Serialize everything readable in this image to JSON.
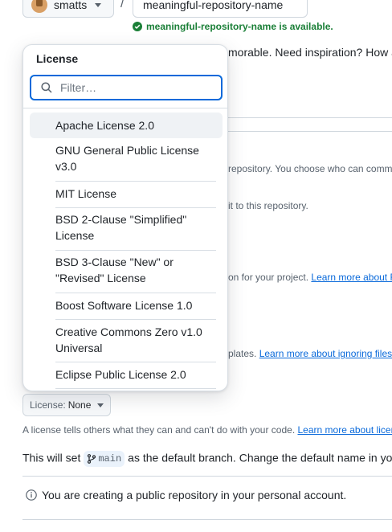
{
  "owner": {
    "name": "smatts"
  },
  "separator": "/",
  "repo_name": {
    "value": "meaningful-repository-name"
  },
  "availability": "meaningful-repository-name is available.",
  "background": {
    "inspiration": "morable. Need inspiration? How a",
    "visibility_desc": "repository. You choose who can comm",
    "commit_desc": "it to this repository.",
    "readme_desc": "on for your project.",
    "readme_link": "Learn more about R",
    "gitignore_desc": "plates.",
    "gitignore_link": "Learn more about ignoring files."
  },
  "license": {
    "button_prefix": "License:",
    "button_value": "None",
    "description": "A license tells others what they can and can't do with your code.",
    "learn_link": "Learn more about licen"
  },
  "branch": {
    "prefix": "This will set",
    "name": "main",
    "suffix": "as the default branch. Change the default name in yo"
  },
  "notice": "You are creating a public repository in your personal account.",
  "dropdown": {
    "title": "License",
    "filter_placeholder": "Filter…",
    "options": [
      {
        "line1": "Apache License 2.0",
        "line2": ""
      },
      {
        "line1": "GNU General Public License",
        "line2": "v3.0"
      },
      {
        "line1": "MIT License",
        "line2": ""
      },
      {
        "line1": "BSD 2-Clause \"Simplified\"",
        "line2": "License"
      },
      {
        "line1": "BSD 3-Clause \"New\" or",
        "line2": "\"Revised\" License"
      },
      {
        "line1": "Boost Software License 1.0",
        "line2": ""
      },
      {
        "line1": "Creative Commons Zero v1.0",
        "line2": "Universal"
      },
      {
        "line1": "Eclipse Public License 2.0",
        "line2": ""
      }
    ]
  },
  "colors": {
    "accent": "#0969da",
    "success": "#1a7f37",
    "text": "#1f2328",
    "muted": "#59636e"
  }
}
